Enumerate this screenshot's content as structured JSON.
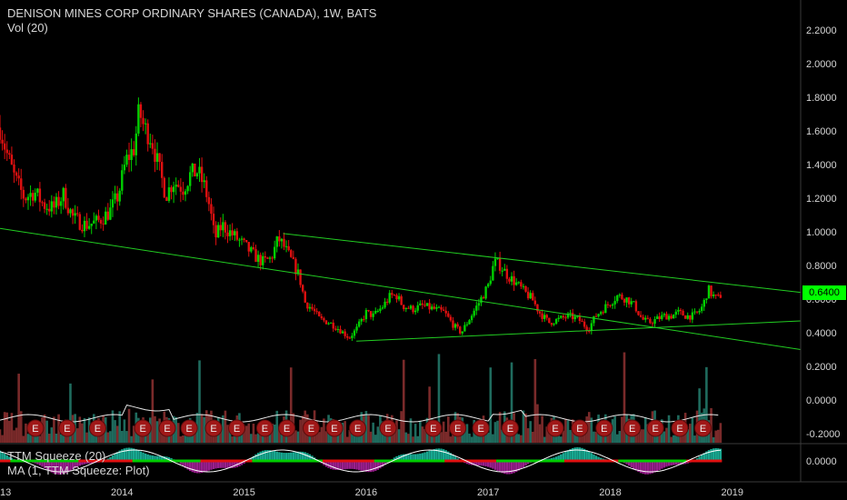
{
  "header": {
    "title": "DENISON MINES CORP ORDINARY SHARES (CANADA), 1W, BATS",
    "volume_label": "Vol (20)",
    "ttm_label": "TTM Squeeze (20)",
    "ma_label": "MA (1, TTM Squeeze: Plot)"
  },
  "colors": {
    "background": "#000000",
    "up": "#00d000",
    "down": "#e01010",
    "trendline": "#22cc22",
    "volume_up": "#1f6b5e",
    "volume_down": "#7a2a2a",
    "volume_ma": "#e8e8e8",
    "earnings_marker": "#a01818",
    "squeeze_pos": "#18a891",
    "squeeze_neg": "#9a1f8e",
    "squeeze_dot_on": "#e01010",
    "squeeze_dot_off": "#00cc00"
  },
  "chart_data": {
    "type": "candlestick",
    "title": "DENISON MINES CORP ORDINARY SHARES (CANADA), 1W, BATS",
    "price_axis": {
      "ticks": [
        "2.2000",
        "2.0000",
        "1.8000",
        "1.6000",
        "1.4000",
        "1.2000",
        "1.0000",
        "0.8000",
        "0.6000",
        "0.4000",
        "0.2000",
        "0.0000",
        "-0.2000"
      ],
      "ylim": [
        -0.25,
        2.3
      ]
    },
    "indicator_axis": {
      "ticks": [
        "0.0000"
      ]
    },
    "time_axis": {
      "ticks": [
        "2013",
        "2014",
        "2015",
        "2016",
        "2017",
        "2018",
        "2019"
      ],
      "first_tick_display": "13",
      "xlim": [
        2013.0,
        2019.56
      ]
    },
    "last_price": "0.6400",
    "price_path": [
      [
        2013.0,
        1.62
      ],
      [
        2013.05,
        1.48
      ],
      [
        2013.12,
        1.32
      ],
      [
        2013.2,
        1.2
      ],
      [
        2013.28,
        1.24
      ],
      [
        2013.36,
        1.16
      ],
      [
        2013.44,
        1.14
      ],
      [
        2013.52,
        1.22
      ],
      [
        2013.6,
        1.08
      ],
      [
        2013.7,
        1.04
      ],
      [
        2013.8,
        1.06
      ],
      [
        2013.9,
        1.12
      ],
      [
        2013.97,
        1.22
      ],
      [
        2014.03,
        1.42
      ],
      [
        2014.1,
        1.5
      ],
      [
        2014.14,
        1.72
      ],
      [
        2014.18,
        1.62
      ],
      [
        2014.24,
        1.56
      ],
      [
        2014.3,
        1.38
      ],
      [
        2014.36,
        1.22
      ],
      [
        2014.42,
        1.3
      ],
      [
        2014.5,
        1.26
      ],
      [
        2014.56,
        1.34
      ],
      [
        2014.62,
        1.36
      ],
      [
        2014.68,
        1.26
      ],
      [
        2014.72,
        1.14
      ],
      [
        2014.76,
        0.96
      ],
      [
        2014.82,
        1.04
      ],
      [
        2014.88,
        1.0
      ],
      [
        2014.94,
        0.96
      ],
      [
        2015.0,
        0.92
      ],
      [
        2015.08,
        0.86
      ],
      [
        2015.15,
        0.82
      ],
      [
        2015.22,
        0.84
      ],
      [
        2015.28,
        0.96
      ],
      [
        2015.32,
        0.92
      ],
      [
        2015.38,
        0.84
      ],
      [
        2015.45,
        0.74
      ],
      [
        2015.5,
        0.58
      ],
      [
        2015.56,
        0.54
      ],
      [
        2015.62,
        0.48
      ],
      [
        2015.7,
        0.46
      ],
      [
        2015.78,
        0.42
      ],
      [
        2015.86,
        0.37
      ],
      [
        2015.92,
        0.42
      ],
      [
        2016.0,
        0.52
      ],
      [
        2016.06,
        0.5
      ],
      [
        2016.14,
        0.56
      ],
      [
        2016.2,
        0.62
      ],
      [
        2016.25,
        0.62
      ],
      [
        2016.3,
        0.56
      ],
      [
        2016.38,
        0.54
      ],
      [
        2016.46,
        0.56
      ],
      [
        2016.56,
        0.54
      ],
      [
        2016.64,
        0.52
      ],
      [
        2016.72,
        0.44
      ],
      [
        2016.78,
        0.4
      ],
      [
        2016.86,
        0.5
      ],
      [
        2016.94,
        0.6
      ],
      [
        2017.0,
        0.68
      ],
      [
        2017.05,
        0.82
      ],
      [
        2017.1,
        0.8
      ],
      [
        2017.16,
        0.74
      ],
      [
        2017.22,
        0.7
      ],
      [
        2017.3,
        0.64
      ],
      [
        2017.36,
        0.6
      ],
      [
        2017.42,
        0.52
      ],
      [
        2017.5,
        0.46
      ],
      [
        2017.58,
        0.48
      ],
      [
        2017.66,
        0.5
      ],
      [
        2017.74,
        0.48
      ],
      [
        2017.82,
        0.42
      ],
      [
        2017.88,
        0.5
      ],
      [
        2017.94,
        0.54
      ],
      [
        2018.0,
        0.58
      ],
      [
        2018.06,
        0.62
      ],
      [
        2018.14,
        0.6
      ],
      [
        2018.2,
        0.56
      ],
      [
        2018.26,
        0.48
      ],
      [
        2018.32,
        0.46
      ],
      [
        2018.38,
        0.48
      ],
      [
        2018.44,
        0.5
      ],
      [
        2018.5,
        0.5
      ],
      [
        2018.56,
        0.52
      ],
      [
        2018.62,
        0.5
      ],
      [
        2018.68,
        0.5
      ],
      [
        2018.72,
        0.52
      ],
      [
        2018.76,
        0.56
      ],
      [
        2018.8,
        0.66
      ],
      [
        2018.84,
        0.62
      ],
      [
        2018.88,
        0.6
      ],
      [
        2018.92,
        0.64
      ]
    ],
    "trendlines": [
      {
        "name": "",
        "from": [
          2013.0,
          1.02
        ],
        "to": [
          2019.56,
          0.3
        ]
      },
      {
        "name": "",
        "from": [
          2015.32,
          0.99
        ],
        "to": [
          2019.56,
          0.64
        ]
      },
      {
        "name": "",
        "from": [
          2015.92,
          0.35
        ],
        "to": [
          2019.56,
          0.47
        ]
      }
    ],
    "earnings_markers": {
      "label": "E",
      "dates": [
        2013.29,
        2013.55,
        2013.8,
        2014.17,
        2014.37,
        2014.55,
        2014.75,
        2014.94,
        2015.17,
        2015.35,
        2015.55,
        2015.74,
        2015.93,
        2016.18,
        2016.55,
        2016.75,
        2016.94,
        2017.18,
        2017.55,
        2017.75,
        2017.95,
        2018.18,
        2018.37,
        2018.57,
        2018.76
      ]
    },
    "volume_ma_level": -0.13,
    "volume_ylim": [
      -0.25,
      0.4
    ]
  }
}
